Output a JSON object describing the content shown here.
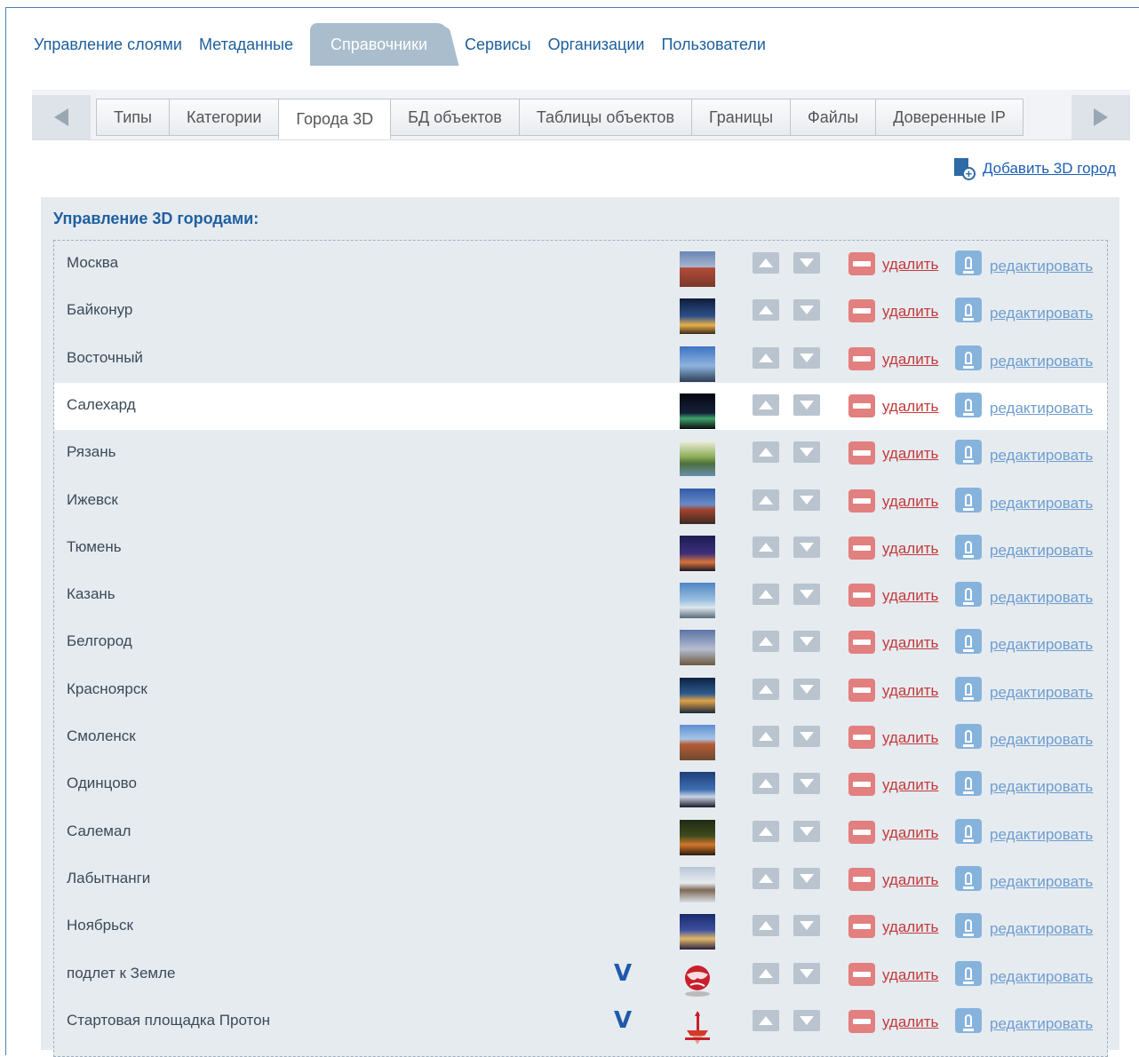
{
  "topnav": {
    "items": [
      {
        "label": "Управление слоями"
      },
      {
        "label": "Метаданные"
      },
      {
        "label": "Справочники",
        "active": true
      },
      {
        "label": "Сервисы"
      },
      {
        "label": "Организации"
      },
      {
        "label": "Пользователи"
      }
    ]
  },
  "tabs": {
    "items": [
      {
        "label": "Типы"
      },
      {
        "label": "Категории"
      },
      {
        "label": "Города 3D",
        "active": true
      },
      {
        "label": "БД объектов"
      },
      {
        "label": "Таблицы объектов"
      },
      {
        "label": "Границы"
      },
      {
        "label": "Файлы"
      },
      {
        "label": "Доверенные IP"
      }
    ]
  },
  "actions": {
    "add_city_label": "Добавить 3D город"
  },
  "panel": {
    "title": "Управление 3D городами:"
  },
  "labels": {
    "delete": "удалить",
    "edit": "редактировать"
  },
  "colors": {
    "accent": "#1f5f9e",
    "delete": "#e27f7f",
    "edit": "#86b3dc",
    "panel_bg": "#e6ebf0",
    "active_tab_bg": "#a9bdcd"
  },
  "cities": [
    {
      "name": "Москва",
      "thumb": "moscow-st-basil-photo"
    },
    {
      "name": "Байконур",
      "thumb": "baikonur-rocket-launch-photo"
    },
    {
      "name": "Восточный",
      "thumb": "vostochny-launch-tower-photo"
    },
    {
      "name": "Салехард",
      "thumb": "salekhard-night-photo",
      "highlighted": true
    },
    {
      "name": "Рязань",
      "thumb": "ryazan-river-photo"
    },
    {
      "name": "Ижевск",
      "thumb": "izhevsk-cathedral-photo"
    },
    {
      "name": "Тюмень",
      "thumb": "tyumen-night-photo"
    },
    {
      "name": "Казань",
      "thumb": "kazan-kremlin-photo"
    },
    {
      "name": "Белгород",
      "thumb": "belgorod-photo"
    },
    {
      "name": "Красноярск",
      "thumb": "krasnoyarsk-night-photo"
    },
    {
      "name": "Смоленск",
      "thumb": "smolensk-church-photo"
    },
    {
      "name": "Одинцово",
      "thumb": "odintsovo-photo"
    },
    {
      "name": "Салемал",
      "thumb": "salemal-campfire-photo"
    },
    {
      "name": "Лабытнанги",
      "thumb": "labytnangi-photo"
    },
    {
      "name": "Ноябрьск",
      "thumb": "noyabrsk-night-photo"
    },
    {
      "name": "подлет к Земле",
      "thumb": "earth-globe-icon",
      "checked": true
    },
    {
      "name": "Стартовая площадка Протон",
      "thumb": "rocket-launch-pad-icon",
      "checked": true
    }
  ]
}
